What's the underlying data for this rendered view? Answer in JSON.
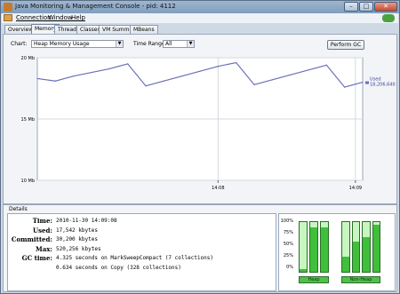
{
  "window": {
    "title": "Java Monitoring & Management Console - pid: 4112"
  },
  "menu": {
    "items": [
      "Connection",
      "Window",
      "Help"
    ]
  },
  "tabs": [
    "Overview",
    "Memory",
    "Threads",
    "Classes",
    "VM Summary",
    "MBeans"
  ],
  "active_tab": "Memory",
  "controls": {
    "chart_label": "Chart:",
    "chart_value": "Heap Memory Usage",
    "timerange_label": "Time Range:",
    "timerange_value": "All",
    "perform_gc": "Perform GC"
  },
  "chart_data": {
    "type": "line",
    "title": "",
    "xlabel": "",
    "ylabel": "",
    "x_ticks": [
      "14:08",
      "14:09"
    ],
    "y_ticks": [
      "20 Mb",
      "15 Mb",
      "10 Mb"
    ],
    "ylim": [
      10,
      20
    ],
    "grid": true,
    "legend": {
      "label": "Used",
      "value": "18,206,640",
      "position": "right"
    },
    "series": [
      {
        "name": "Used",
        "color": "#6a6fb8",
        "x": [
          0,
          5,
          10,
          15,
          20,
          25,
          30,
          35,
          40,
          45,
          50,
          55,
          60,
          65,
          70,
          75,
          80,
          85,
          90
        ],
        "y": [
          18.3,
          18.1,
          18.5,
          18.8,
          19.1,
          19.5,
          17.7,
          18.1,
          18.5,
          18.9,
          19.3,
          19.6,
          17.8,
          18.2,
          18.6,
          19.0,
          19.4,
          17.6,
          18.0
        ]
      }
    ]
  },
  "details": {
    "heading": "Details",
    "rows": [
      {
        "key": "Time:",
        "value": "2010-11-30 14:09:08"
      },
      {
        "key": "Used:",
        "value": "   17,542 kbytes"
      },
      {
        "key": "Committed:",
        "value": "   30,200 kbytes"
      },
      {
        "key": "Max:",
        "value": "  520,256 kbytes"
      },
      {
        "key": "GC time:",
        "value": "  4.325  seconds on MarkSweepCompact (7 collections)"
      },
      {
        "key": "",
        "value": "  0.634  seconds on Copy (328 collections)"
      }
    ]
  },
  "pools": {
    "pct_labels": [
      "100%",
      "75%",
      "50%",
      "25%",
      "0%"
    ],
    "heap_label": "Heap",
    "nonheap_label": "Non-Heap",
    "heap_levels": [
      0.05,
      0.9,
      0.9
    ],
    "nonheap_levels": [
      0.3,
      0.6,
      0.7,
      0.95
    ]
  },
  "colors": {
    "accent": "#3fbf3a",
    "series": "#6a6fb8"
  }
}
